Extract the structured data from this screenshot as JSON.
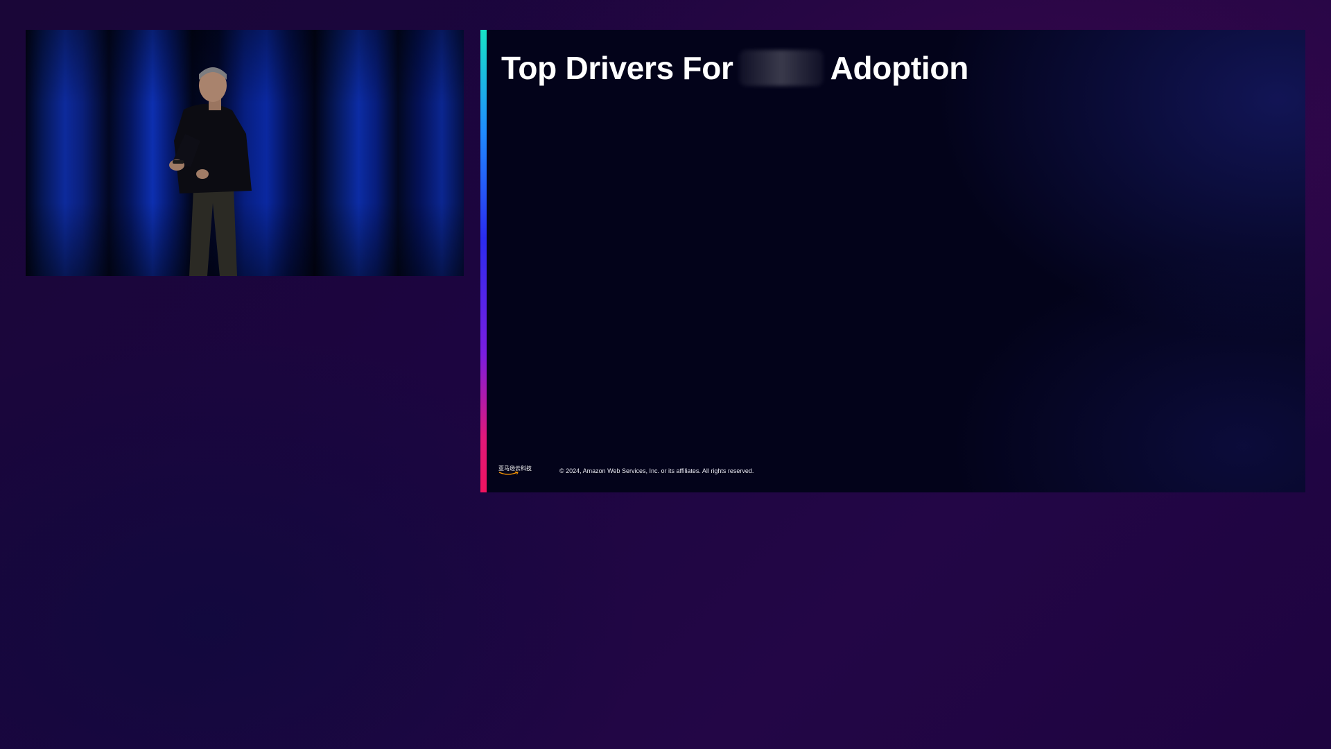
{
  "video": {
    "description_icon": "presenter-icon"
  },
  "slide": {
    "title_prefix": "Top Drivers For",
    "title_suffix": "Adoption",
    "footer": {
      "logo_text": "亚马逊云科技",
      "copyright": "© 2024, Amazon Web Services, Inc. or its affiliates. All rights reserved."
    },
    "accent_colors": [
      "#17e3c6",
      "#2a2cf0",
      "#f0135f"
    ]
  }
}
